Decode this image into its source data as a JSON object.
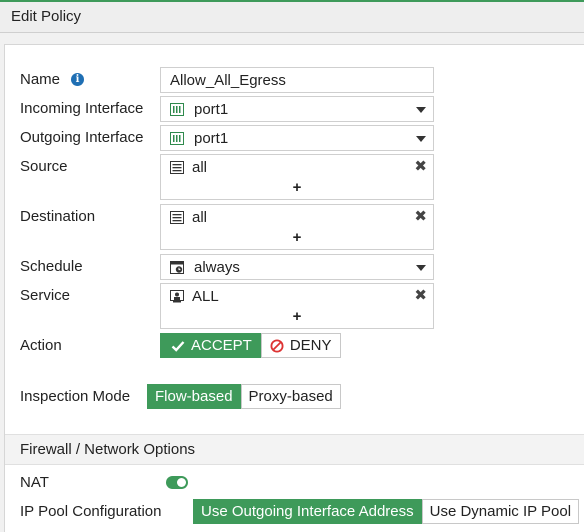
{
  "window": {
    "title": "Edit Policy"
  },
  "form": {
    "name": {
      "label": "Name",
      "value": "Allow_All_Egress"
    },
    "incoming": {
      "label": "Incoming Interface",
      "value": "port1"
    },
    "outgoing": {
      "label": "Outgoing Interface",
      "value": "port1"
    },
    "source": {
      "label": "Source",
      "items": [
        "all"
      ]
    },
    "destination": {
      "label": "Destination",
      "items": [
        "all"
      ]
    },
    "schedule": {
      "label": "Schedule",
      "value": "always"
    },
    "service": {
      "label": "Service",
      "items": [
        "ALL"
      ]
    },
    "action": {
      "label": "Action",
      "accept": "ACCEPT",
      "deny": "DENY",
      "selected": "ACCEPT"
    },
    "inspection": {
      "label": "Inspection Mode",
      "flow": "Flow-based",
      "proxy": "Proxy-based",
      "selected": "Flow-based"
    }
  },
  "firewall_section": {
    "title": "Firewall / Network Options",
    "nat": {
      "label": "NAT",
      "enabled": true
    },
    "ippool": {
      "label": "IP Pool Configuration",
      "outgoing": "Use Outgoing Interface Address",
      "dynamic": "Use Dynamic IP Pool",
      "selected": "Use Outgoing Interface Address"
    }
  },
  "colors": {
    "accent": "#3e9a5a",
    "info": "#1f6fb4",
    "deny": "#d33"
  }
}
